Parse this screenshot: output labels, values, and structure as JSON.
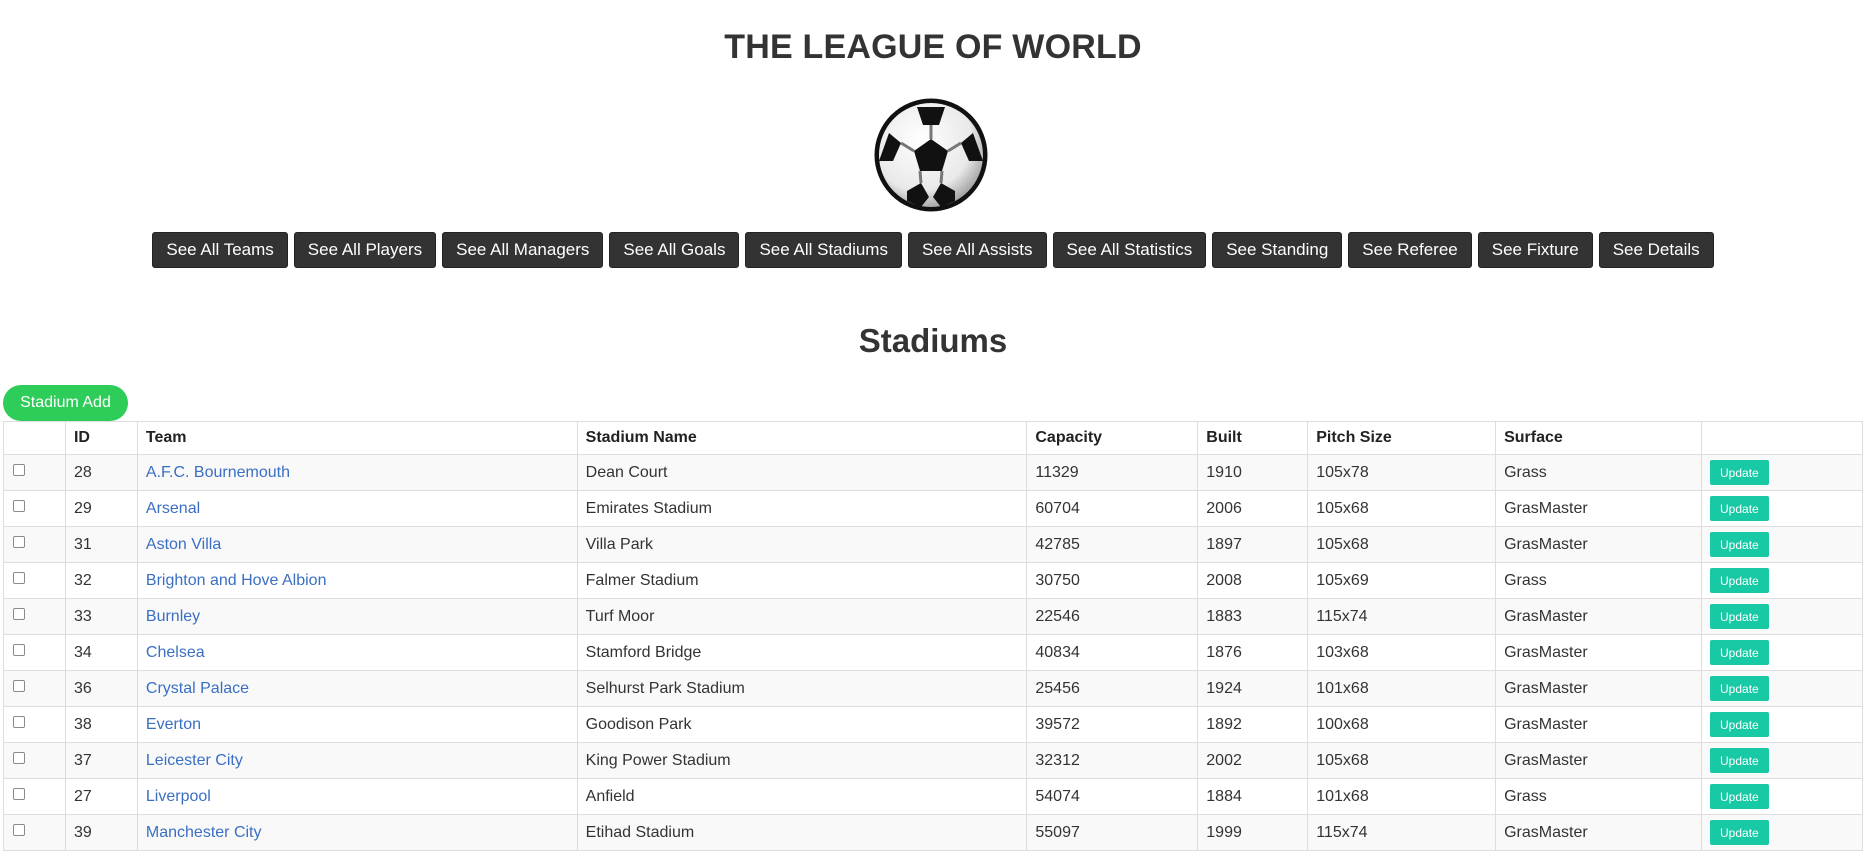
{
  "header": {
    "title": "THE LEAGUE OF WORLD",
    "logo_icon": "soccer-ball-icon"
  },
  "nav": [
    {
      "label": "See All Teams"
    },
    {
      "label": "See All Players"
    },
    {
      "label": "See All Managers"
    },
    {
      "label": "See All Goals"
    },
    {
      "label": "See All Stadiums"
    },
    {
      "label": "See All Assists"
    },
    {
      "label": "See All Statistics"
    },
    {
      "label": "See Standing"
    },
    {
      "label": "See Referee"
    },
    {
      "label": "See Fixture"
    },
    {
      "label": "See Details"
    }
  ],
  "section": {
    "title": "Stadiums",
    "add_label": "Stadium Add"
  },
  "colors": {
    "nav_bg": "#333333",
    "add_btn": "#2ecc59",
    "update_btn": "#17c9a4",
    "link": "#3a6fc4"
  },
  "table": {
    "columns": [
      "",
      "ID",
      "Team",
      "Stadium Name",
      "Capacity",
      "Built",
      "Pitch Size",
      "Surface",
      ""
    ],
    "update_label": "Update",
    "rows": [
      {
        "id": "28",
        "team": "A.F.C. Bournemouth",
        "stadium": "Dean Court",
        "capacity": "11329",
        "built": "1910",
        "pitch": "105x78",
        "surface": "Grass"
      },
      {
        "id": "29",
        "team": "Arsenal",
        "stadium": "Emirates Stadium",
        "capacity": "60704",
        "built": "2006",
        "pitch": "105x68",
        "surface": "GrasMaster"
      },
      {
        "id": "31",
        "team": "Aston Villa",
        "stadium": "Villa Park",
        "capacity": "42785",
        "built": "1897",
        "pitch": "105x68",
        "surface": "GrasMaster"
      },
      {
        "id": "32",
        "team": "Brighton and Hove Albion",
        "stadium": "Falmer Stadium",
        "capacity": "30750",
        "built": "2008",
        "pitch": "105x69",
        "surface": "Grass"
      },
      {
        "id": "33",
        "team": "Burnley",
        "stadium": "Turf Moor",
        "capacity": "22546",
        "built": "1883",
        "pitch": "115x74",
        "surface": "GrasMaster"
      },
      {
        "id": "34",
        "team": "Chelsea",
        "stadium": "Stamford Bridge",
        "capacity": "40834",
        "built": "1876",
        "pitch": "103x68",
        "surface": "GrasMaster"
      },
      {
        "id": "36",
        "team": "Crystal Palace",
        "stadium": "Selhurst Park Stadium",
        "capacity": "25456",
        "built": "1924",
        "pitch": "101x68",
        "surface": "GrasMaster"
      },
      {
        "id": "38",
        "team": "Everton",
        "stadium": "Goodison Park",
        "capacity": "39572",
        "built": "1892",
        "pitch": "100x68",
        "surface": "GrasMaster"
      },
      {
        "id": "37",
        "team": "Leicester City",
        "stadium": "King Power Stadium",
        "capacity": "32312",
        "built": "2002",
        "pitch": "105x68",
        "surface": "GrasMaster"
      },
      {
        "id": "27",
        "team": "Liverpool",
        "stadium": "Anfield",
        "capacity": "54074",
        "built": "1884",
        "pitch": "101x68",
        "surface": "Grass"
      },
      {
        "id": "39",
        "team": "Manchester City",
        "stadium": "Etihad Stadium",
        "capacity": "55097",
        "built": "1999",
        "pitch": "115x74",
        "surface": "GrasMaster"
      }
    ]
  }
}
